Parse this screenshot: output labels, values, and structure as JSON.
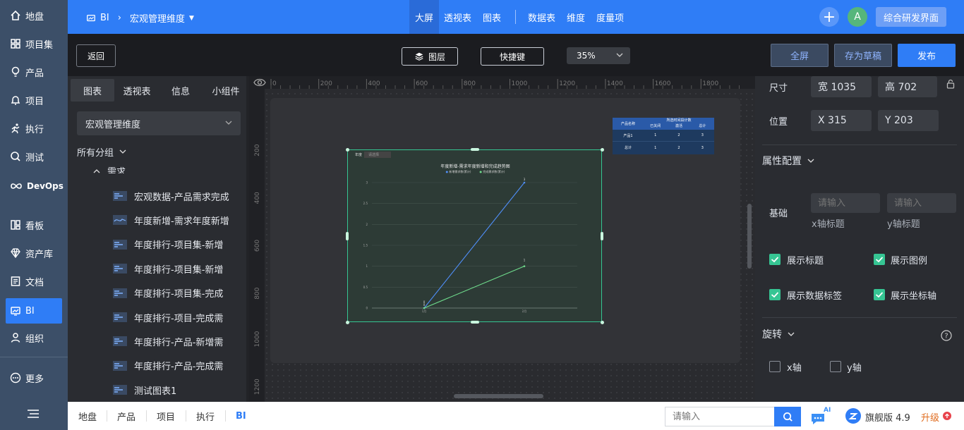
{
  "nav": {
    "items": [
      {
        "label": "地盘",
        "icon": "home-icon"
      },
      {
        "label": "项目集",
        "icon": "grid-icon"
      },
      {
        "label": "产品",
        "icon": "bulb-icon"
      },
      {
        "label": "项目",
        "icon": "bell-icon"
      },
      {
        "label": "执行",
        "icon": "run-icon"
      },
      {
        "label": "测试",
        "icon": "search-icon"
      },
      {
        "label": "DevOps",
        "icon": "infinity-icon"
      },
      {
        "label": "看板",
        "icon": "board-icon"
      },
      {
        "label": "资产库",
        "icon": "diamond-icon"
      },
      {
        "label": "文档",
        "icon": "doc-icon"
      },
      {
        "label": "BI",
        "icon": "monitor-icon"
      },
      {
        "label": "组织",
        "icon": "user-icon"
      },
      {
        "label": "更多",
        "icon": "more-icon"
      }
    ],
    "active": "BI"
  },
  "header": {
    "breadcrumb_root": "BI",
    "breadcrumb_current": "宏观管理维度",
    "tabs": [
      "大屏",
      "透视表",
      "图表",
      "数据表",
      "维度",
      "度量项"
    ],
    "avatar_letter": "A",
    "workspace": "综合研发界面"
  },
  "toolbar": {
    "back": "返回",
    "layers": "图层",
    "shortcut": "快捷键",
    "zoom": "35%",
    "fullscreen": "全屏",
    "save_draft": "存为草稿",
    "publish": "发布"
  },
  "left_panel": {
    "tabs": [
      "图表",
      "透视表",
      "信息",
      "小组件"
    ],
    "dimension_select": "宏观管理维度",
    "group_label": "所有分组",
    "subgroup": "需求",
    "items": [
      "宏观数据-产品需求完成",
      "年度新增-需求年度新增",
      "年度排行-项目集-新增",
      "年度排行-项目集-新增",
      "年度排行-项目集-完成",
      "年度排行-项目-完成需",
      "年度排行-产品-新增需",
      "年度排行-产品-完成需",
      "测试图表1"
    ]
  },
  "ruler": {
    "h_ticks": [
      "0",
      "200",
      "400",
      "600",
      "800",
      "1000",
      "1200",
      "1400",
      "1600",
      "1800"
    ],
    "v_ticks": [
      "200",
      "400",
      "600",
      "800",
      "1000",
      "1200"
    ]
  },
  "mini_table": {
    "title": "所选时间段计数",
    "headers": [
      "产品名称",
      "已关闭",
      "激活",
      "总计"
    ],
    "rows": [
      [
        "产品1",
        "1",
        "2",
        "3"
      ],
      [
        "总计",
        "1",
        "2",
        "3"
      ]
    ]
  },
  "chart_data": {
    "type": "line",
    "title": "年度新增-需求年度新增和完成趋势图",
    "filter_label": "年度",
    "filter_value": "请选择",
    "categories": [
      "1月",
      "2月"
    ],
    "series": [
      {
        "name": "新增需求数(累计)",
        "values": [
          0,
          3
        ],
        "color": "#4f8ef7"
      },
      {
        "name": "完成需求数(累计)",
        "values": [
          0,
          1
        ],
        "color": "#6fdc8c"
      }
    ],
    "ylim": [
      0,
      3
    ],
    "yticks": [
      "0",
      "0.5",
      "1",
      "1.5",
      "2",
      "2.5",
      "3"
    ]
  },
  "right_panel": {
    "size_label": "尺寸",
    "width": "宽 1035",
    "height": "高 702",
    "position_label": "位置",
    "x": "X 315",
    "y": "Y 203",
    "property_config": "属性配置",
    "basic_label": "基础",
    "x_title_placeholder": "请输入",
    "y_title_placeholder": "请输入",
    "x_title_caption": "x轴标题",
    "y_title_caption": "y轴标题",
    "checks": [
      {
        "label": "展示标题",
        "checked": true
      },
      {
        "label": "展示图例",
        "checked": true
      },
      {
        "label": "展示数据标签",
        "checked": true
      },
      {
        "label": "展示坐标轴",
        "checked": true
      }
    ],
    "rotate_label": "旋转",
    "rotate_x": "x轴",
    "rotate_y": "y轴"
  },
  "bottom_bar": {
    "tabs": [
      "地盘",
      "产品",
      "项目",
      "执行",
      "BI"
    ],
    "search_placeholder": "请输入",
    "edition": "旗舰版 4.9",
    "upgrade": "升级",
    "ai_badge": "AI"
  }
}
